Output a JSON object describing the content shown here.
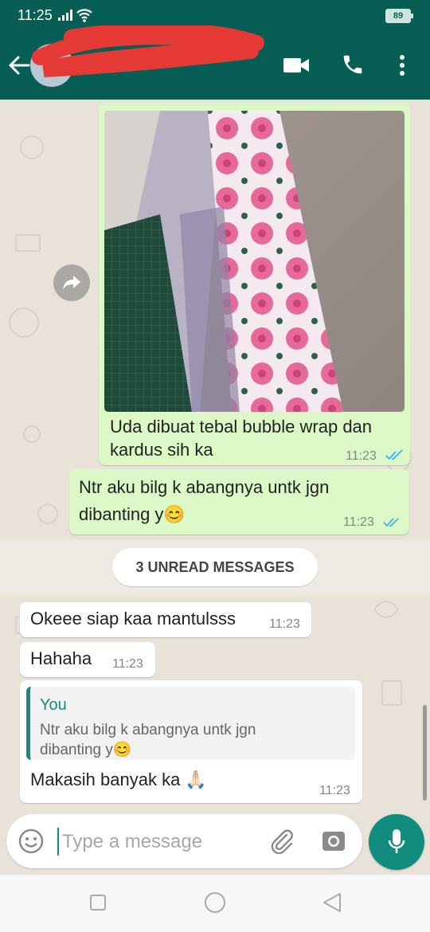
{
  "status_bar": {
    "time": "11:25",
    "battery": "89",
    "icons": [
      "signal-icon",
      "wifi-icon",
      "battery-icon"
    ]
  },
  "header": {
    "contact_name": "",
    "icons": [
      "back-arrow-icon",
      "video-call-icon",
      "voice-call-icon",
      "more-options-icon"
    ]
  },
  "messages": [
    {
      "direction": "out",
      "type": "image",
      "caption": "Uda dibuat tebal bubble wrap dan kardus sih ka",
      "time": "11:23",
      "status": "read"
    },
    {
      "direction": "out",
      "type": "text",
      "text": "Ntr aku bilg k abangnya untk jgn dibanting y😊",
      "time": "11:23",
      "status": "read"
    },
    {
      "direction": "in",
      "type": "text",
      "text": "Okeee siap kaa mantulsss",
      "time": "11:23"
    },
    {
      "direction": "in",
      "type": "text",
      "text": "Hahaha",
      "time": "11:23"
    },
    {
      "direction": "in",
      "type": "reply",
      "quoted_author": "You",
      "quoted_text": "Ntr aku bilg k abangnya untk jgn dibanting y😊",
      "text": "Makasih banyak ka 🙏🏻",
      "time": "11:23"
    }
  ],
  "unread_banner": "3 UNREAD MESSAGES",
  "composer": {
    "placeholder": "Type a message",
    "icons": [
      "emoji-icon",
      "attach-icon",
      "camera-icon",
      "mic-icon"
    ]
  },
  "colors": {
    "header": "#075e54",
    "outgoing_bubble": "#dcf8c6",
    "incoming_bubble": "#ffffff",
    "accent": "#128c7e",
    "read_ticks": "#34b7f1"
  },
  "nav_bar": {
    "icons": [
      "recent-apps-icon",
      "home-icon",
      "back-icon"
    ]
  }
}
